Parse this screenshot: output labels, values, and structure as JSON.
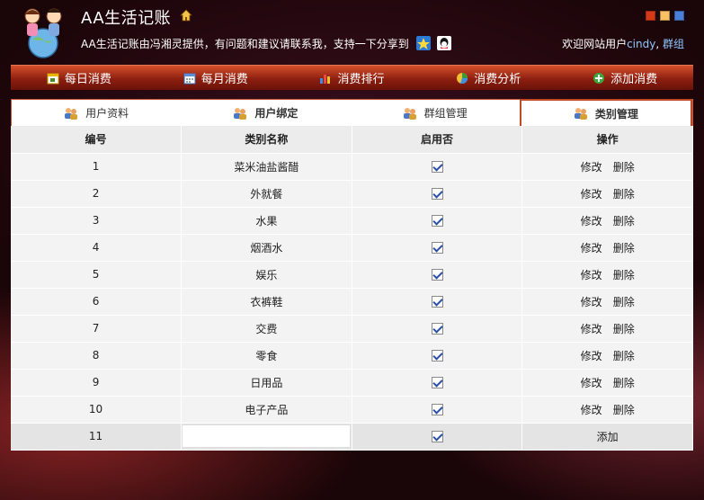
{
  "header": {
    "app_title": "AA生活记账",
    "subtitle": "AA生活记账由冯湘灵提供，有问题和建议请联系我，支持一下分享到",
    "welcome_text": "欢迎网站用户",
    "username": "cindy",
    "group_link": "群组",
    "separator": ", ",
    "swatch_colors": [
      "#d43a18",
      "#f7c261",
      "#4a7fd8"
    ]
  },
  "nav": {
    "items": [
      {
        "label": "每日消费",
        "icon": "calendar-day-icon"
      },
      {
        "label": "每月消费",
        "icon": "calendar-month-icon"
      },
      {
        "label": "消费排行",
        "icon": "bar-chart-icon"
      },
      {
        "label": "消费分析",
        "icon": "pie-chart-icon"
      },
      {
        "label": "添加消费",
        "icon": "add-icon"
      }
    ]
  },
  "tabs": [
    {
      "label": "用户资料",
      "icon": "users-icon"
    },
    {
      "label": "用户绑定",
      "icon": "users-icon"
    },
    {
      "label": "群组管理",
      "icon": "users-icon"
    },
    {
      "label": "类别管理",
      "icon": "users-icon"
    }
  ],
  "table": {
    "headers": [
      "编号",
      "类别名称",
      "启用否",
      "操作"
    ],
    "rows": [
      {
        "id": "1",
        "name": "菜米油盐酱醋",
        "enabled": true
      },
      {
        "id": "2",
        "name": "外就餐",
        "enabled": true
      },
      {
        "id": "3",
        "name": "水果",
        "enabled": true
      },
      {
        "id": "4",
        "name": "烟酒水",
        "enabled": true
      },
      {
        "id": "5",
        "name": "娱乐",
        "enabled": true
      },
      {
        "id": "6",
        "name": "衣裤鞋",
        "enabled": true
      },
      {
        "id": "7",
        "name": "交费",
        "enabled": true
      },
      {
        "id": "8",
        "name": "零食",
        "enabled": true
      },
      {
        "id": "9",
        "name": "日用品",
        "enabled": true
      },
      {
        "id": "10",
        "name": "电子产品",
        "enabled": true
      }
    ],
    "edit_label": "修改",
    "delete_label": "删除",
    "new_row": {
      "id": "11",
      "name_value": "",
      "enabled": true,
      "add_label": "添加"
    }
  }
}
